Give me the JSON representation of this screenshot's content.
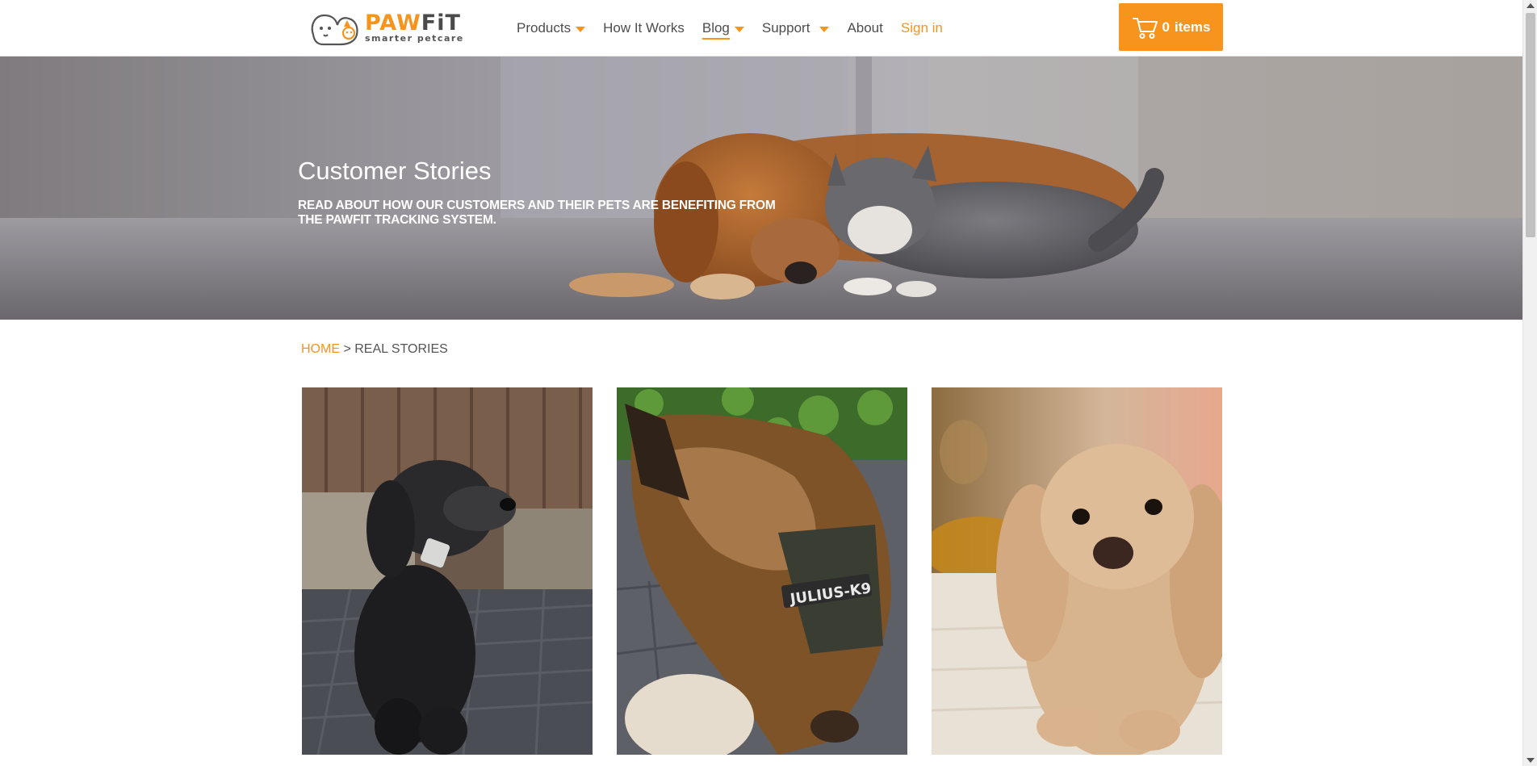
{
  "header": {
    "logo": {
      "word_left": "PAW",
      "word_right": "FiT",
      "tagline": "smarter petcare"
    },
    "nav": [
      {
        "label": "Products",
        "has_dropdown": true
      },
      {
        "label": "How It Works",
        "has_dropdown": false
      },
      {
        "label": "Blog",
        "has_dropdown": true,
        "active": true
      },
      {
        "label": "Support",
        "has_dropdown": true
      },
      {
        "label": "About",
        "has_dropdown": false
      },
      {
        "label": "Sign in",
        "has_dropdown": false
      }
    ],
    "cart": {
      "count": "0",
      "label": "items",
      "icon": "cart-icon"
    }
  },
  "hero": {
    "title": "Customer Stories",
    "subtitle": "READ ABOUT HOW OUR CUSTOMERS AND THEIR PETS ARE BENEFITING FROM THE PAWFIT TRACKING SYSTEM."
  },
  "breadcrumb": {
    "home": "HOME",
    "separator": ">",
    "current": "REAL STORIES"
  },
  "gallery": {
    "cards": [
      {
        "subject": "black curly dog wearing a tracker on a wicker chair"
      },
      {
        "subject": "german shepherd wearing a harness lying on a patio",
        "harness_text": "JULIUS-K9"
      },
      {
        "subject": "cream cocker spaniel on a blanket"
      }
    ]
  },
  "colors": {
    "accent": "#f7941d",
    "text": "#4d4d4d",
    "hero_text": "#ffffff"
  }
}
